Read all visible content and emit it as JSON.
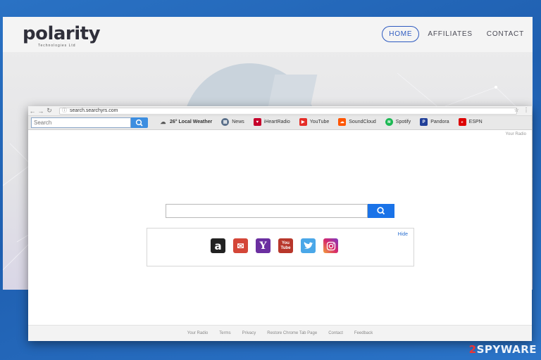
{
  "site": {
    "logo": "polarity",
    "logo_sub": "Technologies Ltd",
    "nav": [
      "HOME",
      "AFFILIATES",
      "CONTACT"
    ]
  },
  "browser": {
    "url": "search.searchyrs.com",
    "toolbar_search_placeholder": "Search",
    "toolbar_links": [
      {
        "label": "26° Local Weather",
        "icon": "weather-icon"
      },
      {
        "label": "News",
        "icon": "news-icon",
        "color": "#5a6f8a"
      },
      {
        "label": "iHeartRadio",
        "icon": "iheartradio-icon",
        "color": "#c6002b"
      },
      {
        "label": "YouTube",
        "icon": "youtube-icon",
        "color": "#e52d27"
      },
      {
        "label": "SoundCloud",
        "icon": "soundcloud-icon",
        "color": "#ff5500"
      },
      {
        "label": "Spotify",
        "icon": "spotify-icon",
        "color": "#1db954"
      },
      {
        "label": "Pandora",
        "icon": "pandora-icon",
        "color": "#224099"
      },
      {
        "label": "ESPN",
        "icon": "espn-icon",
        "color": "#d00"
      }
    ],
    "your_radio": "Your Radio",
    "hide_label": "Hide",
    "shortcuts": [
      {
        "name": "amazon-icon",
        "glyph": "a",
        "color": "#222"
      },
      {
        "name": "gmail-icon",
        "glyph": "✉",
        "color": "#d44638"
      },
      {
        "name": "yahoo-icon",
        "glyph": "Y",
        "color": "#6b2fa0"
      },
      {
        "name": "youtube-icon",
        "glyph": "You",
        "color": "#b8372b"
      },
      {
        "name": "twitter-icon",
        "glyph": "🐦",
        "color": "#4aa7e8"
      },
      {
        "name": "instagram-icon",
        "glyph": "◎",
        "color": "#c8307a"
      }
    ],
    "footer_links": [
      "Your Radio",
      "Terms",
      "Privacy",
      "Restore Chrome Tab Page",
      "Contact",
      "Feedback"
    ]
  },
  "watermark": {
    "number": "2",
    "text": "SPYWARE"
  },
  "colors": {
    "accent": "#1a73e8",
    "nav_active": "#2d5ac0"
  }
}
